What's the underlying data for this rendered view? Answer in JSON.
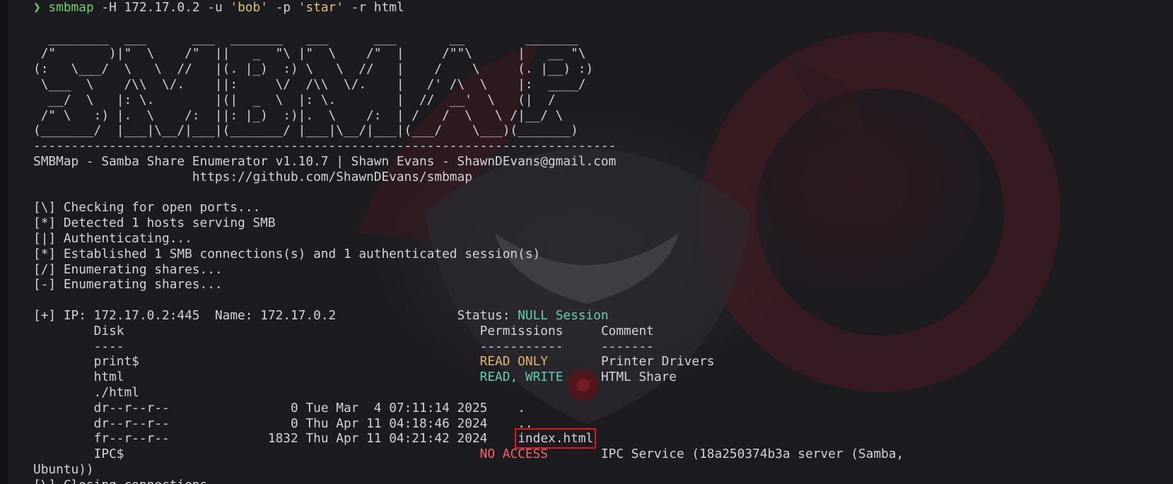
{
  "prompt": {
    "glyph": "❯",
    "command": "smbmap",
    "args_pre": " -H 172.17.0.2 -u ",
    "user": "'bob'",
    "args_mid": " -p ",
    "password": "'star'",
    "args_post": " -r html"
  },
  "banner": {
    "art": [
      "  ________  ___      ___  _______   ___      ___       __        _______",
      " /\"       )|\"  \\    /\"  ||   _  \"\\ |\"  \\    /\"  |     /\"\"\\      |   __ \"\\",
      "(:   \\___/  \\   \\  //   |(. |_)  :) \\   \\  //   |    /    \\     (. |__) :)",
      " \\___  \\    /\\\\  \\/.    ||:     \\/  /\\\\  \\/.    |   /' /\\  \\    |:  ____/",
      "  __/  \\   |: \\.        |(|  _  \\  |: \\.        |  //  __'  \\   (|  /",
      " /\" \\   :) |.  \\    /:  ||: |_)  :)|.  \\    /:  | /   /  \\   \\ /|__/ \\",
      "(_______/  |___|\\__/|___|(_______/ |___|\\__/|___|(___/    \\___)(_______)"
    ],
    "rule": "-----------------------------------------------------------------------------",
    "title": "SMBMap - Samba Share Enumerator v1.10.7 | Shawn Evans - ShawnDEvans@gmail.com",
    "url": "https://github.com/ShawnDEvans/smbmap"
  },
  "status_lines": [
    "[\\] Checking for open ports...",
    "[*] Detected 1 hosts serving SMB",
    "[|] Authenticating...",
    "[*] Established 1 SMB connections(s) and 1 authenticated session(s)",
    "[/] Enumerating shares...",
    "[-] Enumerating shares..."
  ],
  "host": {
    "prefix": "[+] IP: 172.17.0.2:445  Name: 172.17.0.2",
    "status_label": "Status:",
    "status_value": "NULL Session"
  },
  "table": {
    "col_disk": "Disk",
    "col_permissions": "Permissions",
    "col_comment": "Comment",
    "sep_disk": "----",
    "sep_permissions": "-----------",
    "sep_comment": "-------"
  },
  "shares": [
    {
      "name": "print$",
      "permission": "READ ONLY",
      "comment": "Printer Drivers"
    },
    {
      "name": "html",
      "permission": "READ, WRITE",
      "comment": "HTML Share"
    }
  ],
  "listing": {
    "path": "./html",
    "entries": [
      {
        "mode": "dr--r--r--",
        "size": "0",
        "date": "Tue Mar  4 07:11:14 2025",
        "name": "."
      },
      {
        "mode": "dr--r--r--",
        "size": "0",
        "date": "Thu Apr 11 04:18:46 2024",
        "name": ".."
      },
      {
        "mode": "fr--r--r--",
        "size": "1832",
        "date": "Thu Apr 11 04:21:42 2024",
        "name": "index.html"
      }
    ]
  },
  "ipc": {
    "name": "IPC$",
    "permission": "NO ACCESS",
    "comment": "IPC Service (18a250374b3a server (Samba,",
    "comment_wrap": "Ubuntu))"
  },
  "cutoff_line": "[\\] Closing connections..",
  "colors": {
    "background": "#1c1b20",
    "foreground": "#d4d4d6",
    "prompt_green": "#6bd16b",
    "string_yellow": "#e3c16f",
    "teal": "#5fd0b4",
    "gold": "#e3b56a",
    "red": "#f0646e",
    "highlight_box": "#e01919"
  }
}
